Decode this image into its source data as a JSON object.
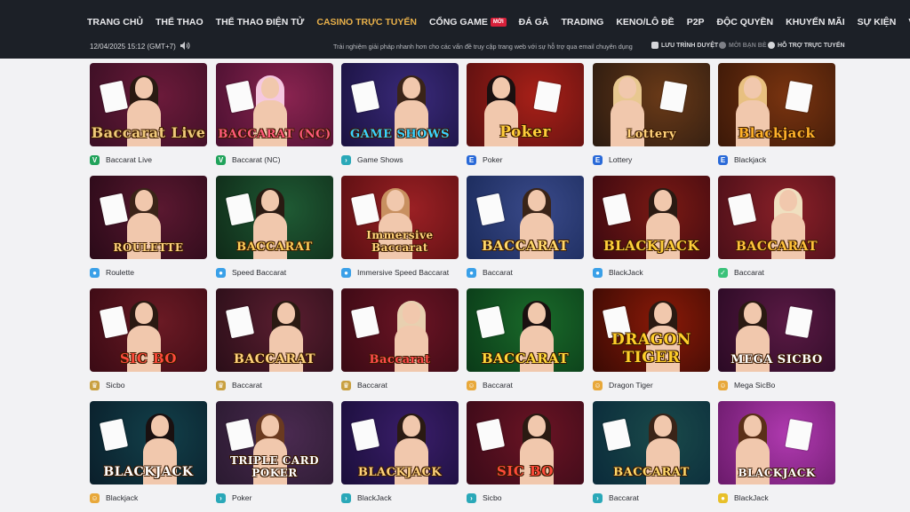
{
  "nav": {
    "items": [
      {
        "label": "TRANG CHỦ"
      },
      {
        "label": "THỂ THAO"
      },
      {
        "label": "THỂ THAO ĐIỆN TỬ"
      },
      {
        "label": "CASINO TRỰC TUYẾN",
        "active": true
      },
      {
        "label": "CỔNG GAME",
        "badge": "MỚI"
      },
      {
        "label": "ĐÁ GÀ"
      },
      {
        "label": "TRADING"
      },
      {
        "label": "KENO/LÔ ĐỀ"
      },
      {
        "label": "P2P"
      },
      {
        "label": "ĐỘC QUYỀN"
      },
      {
        "label": "KHUYẾN MÃI"
      },
      {
        "label": "SỰ KIỆN"
      },
      {
        "label": "VIP"
      }
    ]
  },
  "subbar": {
    "datetime": "12/04/2025 15:12 (GMT+7)",
    "speaker_icon": "speaker-icon",
    "announcement": "Trải nghiệm giải pháp nhanh hơn cho các vấn đề truy cập trang web với sự hỗ trợ qua email chuyên dụng",
    "bookmark": "LƯU TRÌNH DUYỆT",
    "invite": "MỜI BẠN BÈ",
    "support": "HỖ TRỢ TRỰC TUYẾN"
  },
  "colors": {
    "topbar": "#1c2027",
    "accent": "#e8b04a",
    "page_bg": "#f2f2f4"
  },
  "games": [
    {
      "name": "Baccarat Live",
      "provider_icon": "v-provider-icon",
      "art_title": "Baccarat Live"
    },
    {
      "name": "Baccarat (NC)",
      "provider_icon": "v-provider-icon",
      "art_title": "BACCARAT (NC)"
    },
    {
      "name": "Game Shows",
      "provider_icon": "arrow-provider-icon",
      "art_title": "GAME SHOWS"
    },
    {
      "name": "Poker",
      "provider_icon": "e-provider-icon",
      "art_title": "Poker"
    },
    {
      "name": "Lottery",
      "provider_icon": "e-provider-icon",
      "art_title": "Lottery"
    },
    {
      "name": "Blackjack",
      "provider_icon": "e-provider-icon",
      "art_title": "Blackjack"
    },
    {
      "name": "Roulette",
      "provider_icon": "drop-provider-icon",
      "art_title": "ROULETTE"
    },
    {
      "name": "Speed Baccarat",
      "provider_icon": "drop-provider-icon",
      "art_title": "BACCARAT"
    },
    {
      "name": "Immersive Speed Baccarat",
      "provider_icon": "drop-provider-icon",
      "art_title": "Immersive Baccarat"
    },
    {
      "name": "Baccarat",
      "provider_icon": "drop-provider-icon",
      "art_title": "BACCARAT"
    },
    {
      "name": "BlackJack",
      "provider_icon": "drop-provider-icon",
      "art_title": "BLACKJACK"
    },
    {
      "name": "Baccarat",
      "provider_icon": "leaf-provider-icon",
      "art_title": "BACCARAT"
    },
    {
      "name": "Sicbo",
      "provider_icon": "crown-provider-icon",
      "art_title": "SIC BO"
    },
    {
      "name": "Baccarat",
      "provider_icon": "crown-provider-icon",
      "art_title": "BACCARAT"
    },
    {
      "name": "Baccarat",
      "provider_icon": "crown-provider-icon",
      "art_title": "Baccarat"
    },
    {
      "name": "Baccarat",
      "provider_icon": "face-provider-icon",
      "art_title": "BACCARAT"
    },
    {
      "name": "Dragon Tiger",
      "provider_icon": "face-provider-icon",
      "art_title": "DRAGON TIGER"
    },
    {
      "name": "Mega SicBo",
      "provider_icon": "face-provider-icon",
      "art_title": "MEGA SICBO"
    },
    {
      "name": "Blackjack",
      "provider_icon": "face-provider-icon",
      "art_title": "BLACKJACK"
    },
    {
      "name": "Poker",
      "provider_icon": "arrow-provider-icon",
      "art_title": "TRIPLE CARD POKER"
    },
    {
      "name": "BlackJack",
      "provider_icon": "arrow-provider-icon",
      "art_title": "BLACKJACK"
    },
    {
      "name": "Sicbo",
      "provider_icon": "arrow-provider-icon",
      "art_title": "SIC BO"
    },
    {
      "name": "Baccarat",
      "provider_icon": "arrow-provider-icon",
      "art_title": "BACCARAT"
    },
    {
      "name": "BlackJack",
      "provider_icon": "coin-provider-icon",
      "art_title": "BLACKJACK"
    }
  ]
}
